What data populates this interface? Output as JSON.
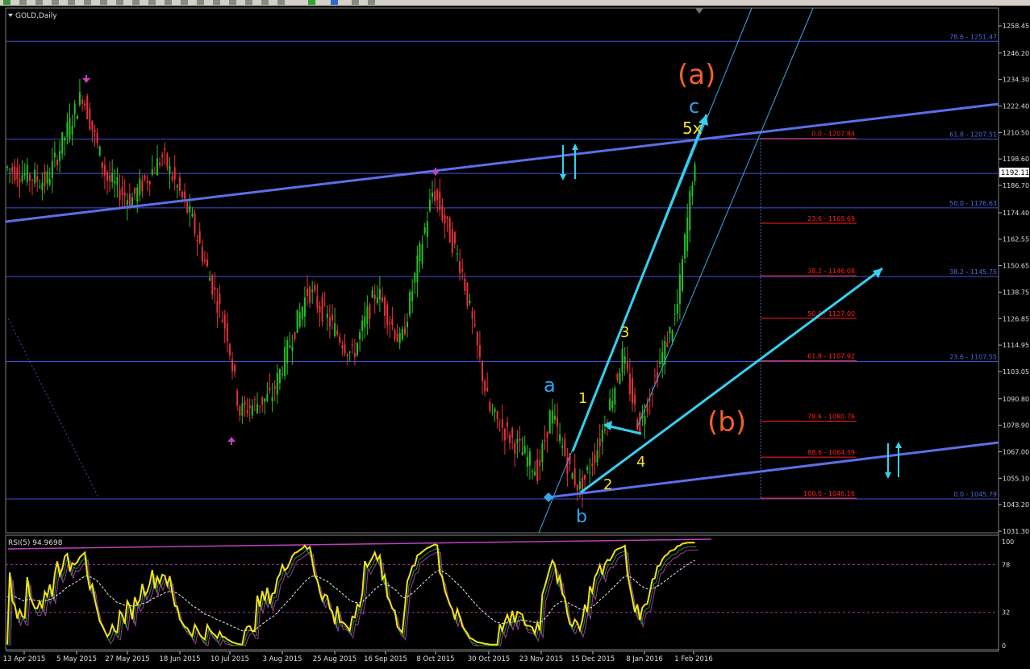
{
  "window": {
    "title": "GOLD,Daily"
  },
  "colors": {
    "up": "#22c322",
    "down": "#e8313a",
    "hline": "#3f51d6",
    "trend": "#5c6fe8",
    "cyan": "#34d0f0",
    "orange": "#f06127",
    "yellow": "#f2e21b",
    "fibRed": "#ff2020",
    "fibBlue": "#4b6cd8",
    "magenta": "#c040c0"
  },
  "price_scale": {
    "ticks": [
      "1258.45",
      "1246.20",
      "1234.30",
      "1222.40",
      "1210.50",
      "1198.60",
      "1186.70",
      "1174.40",
      "1162.55",
      "1150.65",
      "1138.75",
      "1126.85",
      "1114.95",
      "1103.05",
      "1090.80",
      "1078.90",
      "1067.00",
      "1055.10",
      "1043.20",
      "1031.30"
    ],
    "current": "1192.11"
  },
  "time_axis": [
    "13 Apr 2015",
    "5 May 2015",
    "27 May 2015",
    "18 Jun 2015",
    "10 Jul 2015",
    "3 Aug 2015",
    "25 Aug 2015",
    "16 Sep 2015",
    "8 Oct 2015",
    "30 Oct 2015",
    "23 Nov 2015",
    "15 Dec 2015",
    "8 Jan 2016",
    "1 Feb 2016"
  ],
  "fib_right_labels": [
    "78.6 - 1251.47",
    "61.8 - 1207.51",
    "50.0 - 1176.63",
    "38.2 - 1145.75",
    "23.6 - 1107.55",
    "0.0 - 1045.79"
  ],
  "fib_red_labels": [
    "0.0 - 1207.84",
    "23.6 - 1169.69",
    "38.2 - 1146.08",
    "50.0 - 1127.00",
    "61.8 - 1107.92",
    "78.6 - 1080.76",
    "88.6 - 1064.59",
    "100.0 - 1046.16"
  ],
  "wave_labels": {
    "a_big": "(a)",
    "b_big": "(b)",
    "c": "c",
    "five_x": "5x",
    "a": "a",
    "b": "b",
    "w1": "1",
    "w2": "2",
    "w3": "3",
    "w4": "4"
  },
  "rsi": {
    "title": "RSI(5) 94.9698",
    "levels": [
      "100",
      "78",
      "32",
      "0"
    ]
  }
}
